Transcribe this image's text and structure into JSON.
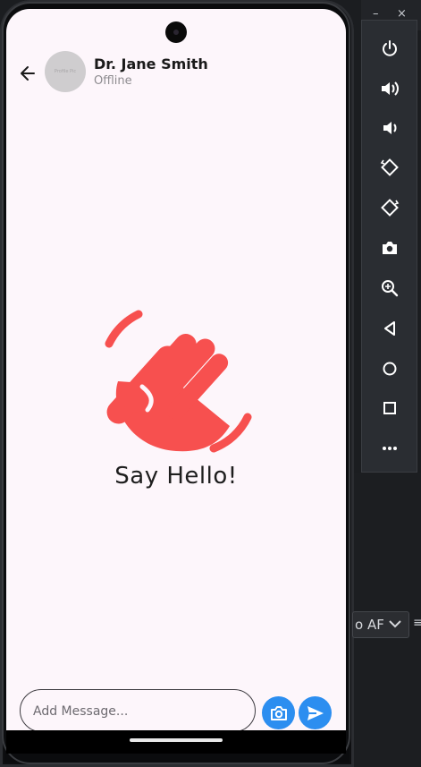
{
  "chat": {
    "contact_name": "Dr. Jane Smith",
    "contact_status": "Offline",
    "avatar_placeholder": "Profile Pic",
    "empty_state_text": "Say Hello!",
    "input_placeholder": "Add Message...",
    "accent_color": "#2c8ef0",
    "illustration_color": "#f7504f"
  },
  "icons": {
    "back": "arrow-left-icon",
    "camera": "camera-icon",
    "send": "send-icon",
    "wave": "waving-hand-icon"
  },
  "emulator": {
    "buttons": [
      "power-icon",
      "volume-up-icon",
      "volume-down-icon",
      "rotate-left-icon",
      "rotate-right-icon",
      "screenshot-icon",
      "zoom-icon",
      "back-icon",
      "home-icon",
      "overview-icon",
      "more-icon"
    ],
    "minimize_label": "–",
    "close_label": "×"
  },
  "ide": {
    "dropdown_partial_text": "o AF"
  }
}
